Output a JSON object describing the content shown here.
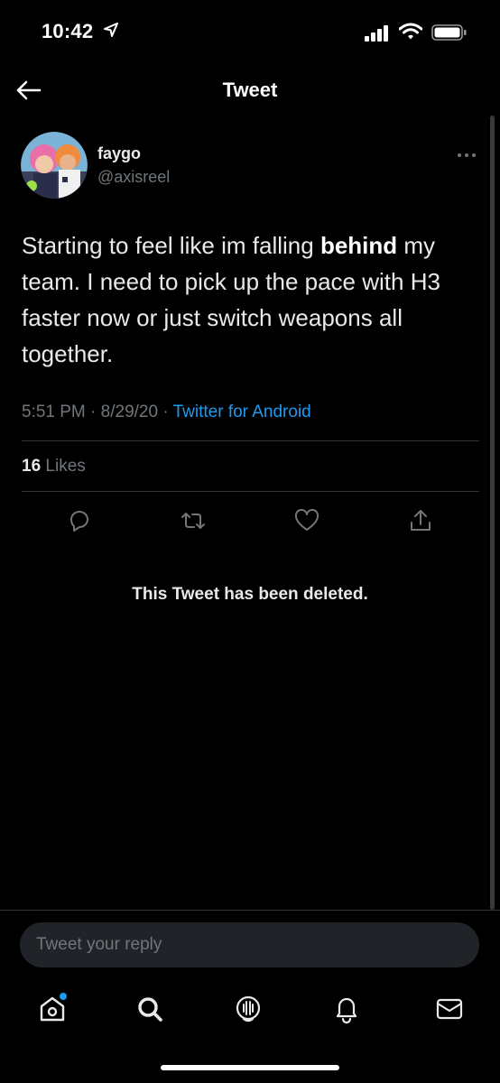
{
  "status_bar": {
    "time": "10:42"
  },
  "header": {
    "title": "Tweet"
  },
  "tweet": {
    "author_name": "faygo",
    "author_handle": "@axisreel",
    "text_before": "Starting to feel like im falling ",
    "text_bold": "behind",
    "text_after": " my team. I need to pick up the pace with H3 faster now or just switch weapons all together.",
    "time": "5:51 PM",
    "date": "8/29/20",
    "separator": " · ",
    "source": "Twitter for Android",
    "likes_count": "16",
    "likes_label": " Likes"
  },
  "thread": {
    "deleted_notice": "This Tweet has been deleted."
  },
  "reply": {
    "placeholder": "Tweet your reply"
  },
  "bottom_nav": {
    "items": [
      "home-icon",
      "search-icon",
      "spaces-icon",
      "notifications-icon",
      "messages-icon"
    ]
  },
  "colors": {
    "background": "#000000",
    "accent": "#1d9bf0",
    "secondary_text": "#71767b",
    "divider": "#2f3336"
  }
}
